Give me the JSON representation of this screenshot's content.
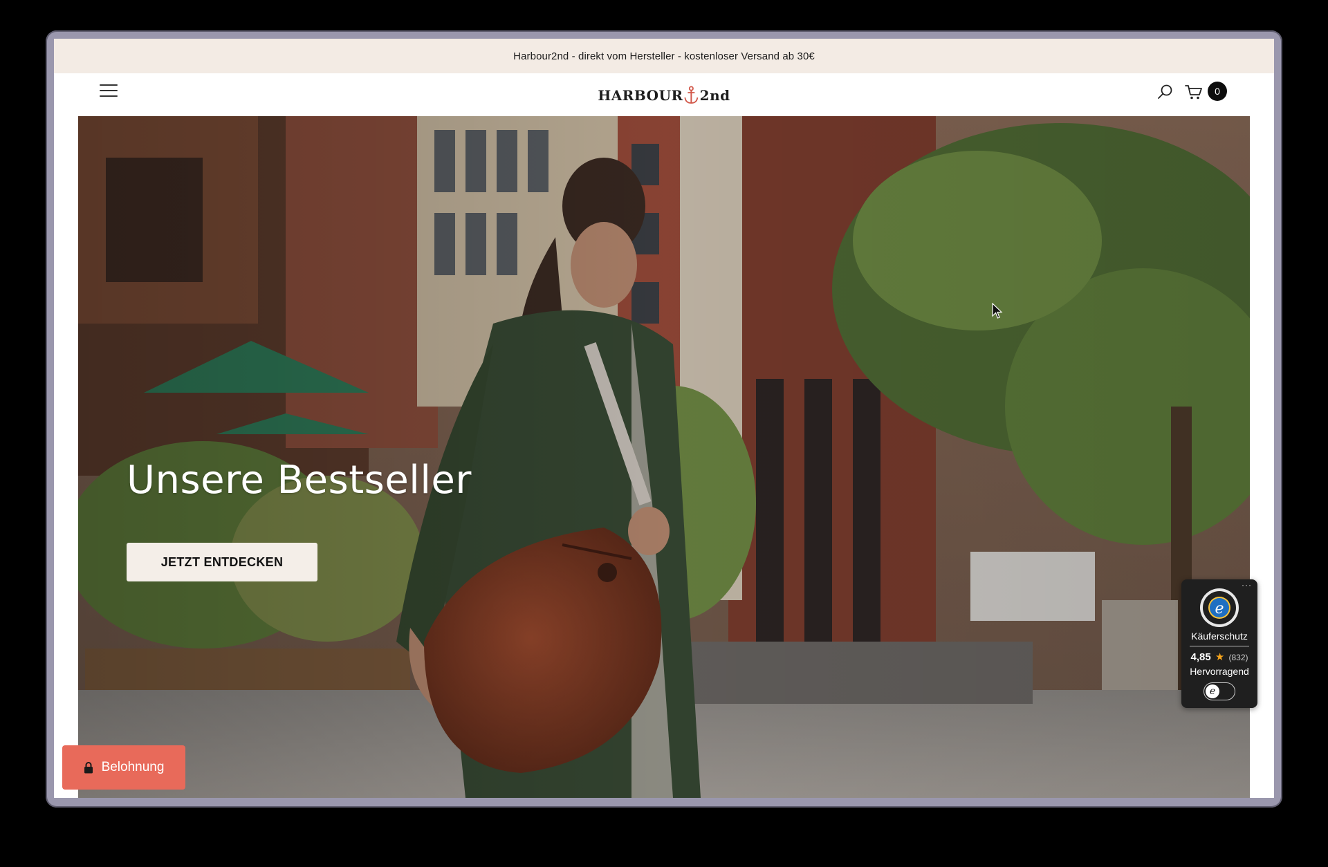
{
  "announcement": {
    "text": "Harbour2nd - direkt vom Hersteller - kostenloser Versand ab 30€"
  },
  "header": {
    "logo_left": "HARBOUR",
    "logo_right": "2nd",
    "cart_count": "0",
    "menu_icon": "hamburger-menu-icon",
    "search_icon": "search-icon",
    "cart_icon": "cart-icon"
  },
  "hero": {
    "title": "Unsere Bestseller",
    "cta_label": "JETZT ENTDECKEN"
  },
  "trust_badge": {
    "label": "Käuferschutz",
    "score": "4,85",
    "reviews": "(832)",
    "grade": "Hervorragend",
    "more_icon": "more-dots-icon",
    "seal_icon": "trusted-shops-seal-icon",
    "star_icon": "star-icon",
    "toggle_letter": "e"
  },
  "reward": {
    "label": "Belohnung",
    "icon": "lock-icon"
  },
  "colors": {
    "announcement_bg": "#f3ebe4",
    "reward_bg": "#e86a5a",
    "cta_bg": "#f4eee8",
    "badge_bg": "#1f1f1f",
    "star": "#f7a51c"
  }
}
